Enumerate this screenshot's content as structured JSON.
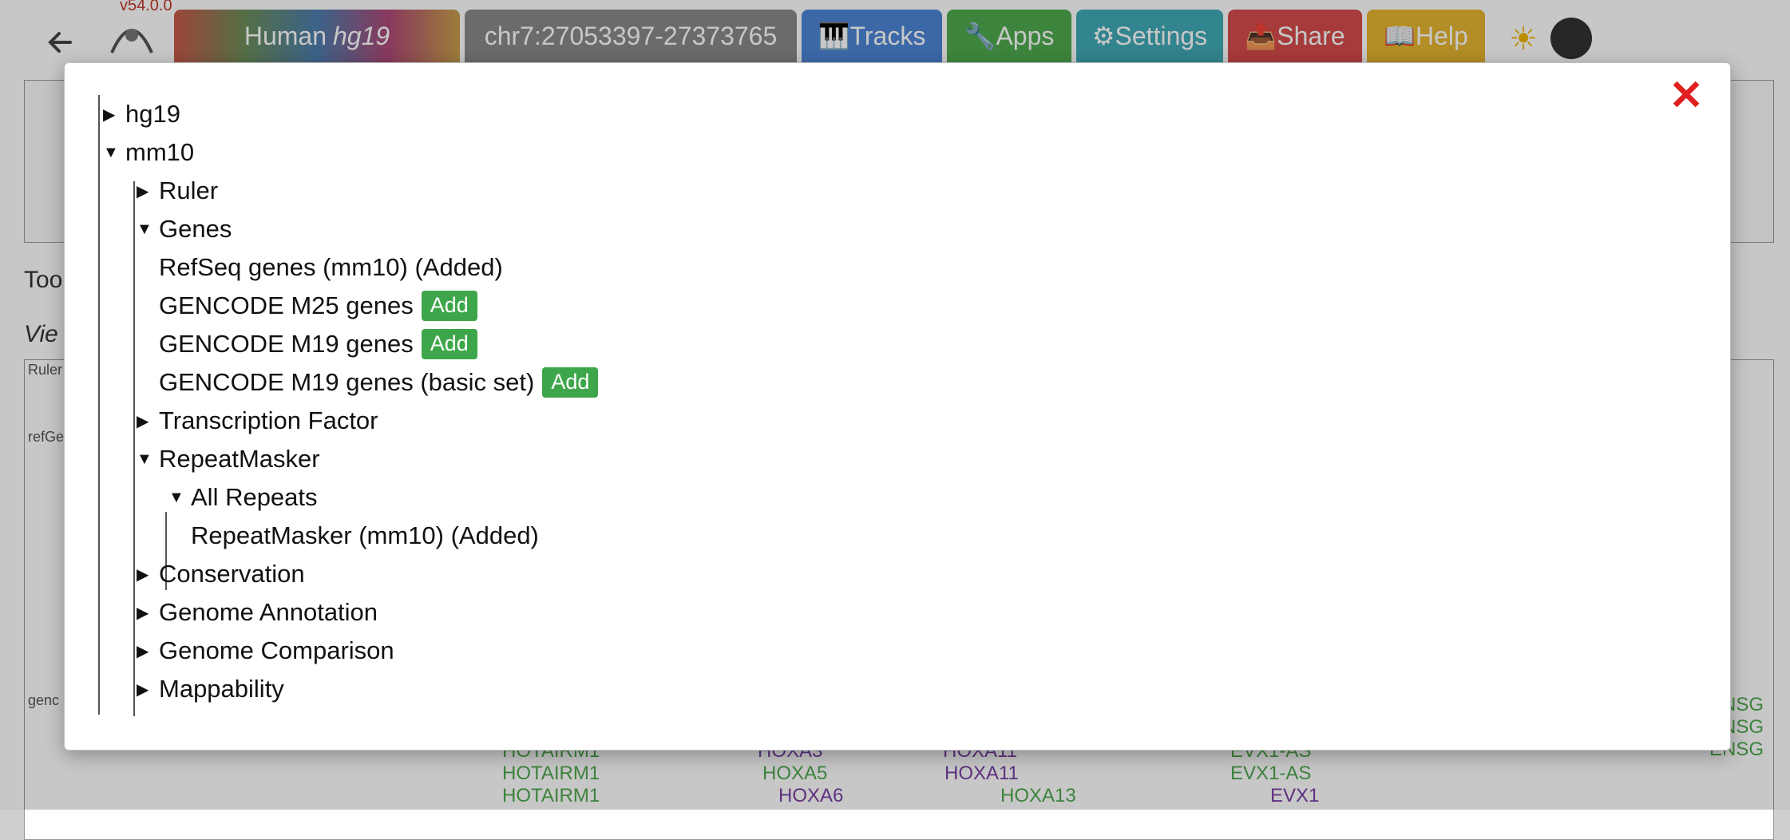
{
  "app": {
    "version": "v54.0.0",
    "genome_species": "Human",
    "genome_assembly": "hg19",
    "locus": "chr7:27053397-27373765",
    "nav": {
      "tracks": "🎹Tracks",
      "apps": "🔧Apps",
      "settings": "⚙Settings",
      "share": "📤Share",
      "help": "📖Help"
    },
    "background": {
      "tools_label": "Too",
      "view_label": "Vie",
      "ruler_label": "Ruler",
      "refgene_label": "refGe",
      "gencode_label": "genc",
      "genes": [
        "HOTAIRM1",
        "HOTAIRM1",
        "HOTAIRM1",
        "HOXA3",
        "HOXA5",
        "HOXA6",
        "HOXA11",
        "HOXA11",
        "HOXA13",
        "EVX1-AS",
        "EVX1-AS",
        "EVX1",
        "ENSG",
        "ENSG",
        "ENSG"
      ]
    }
  },
  "icons": {
    "back": "back-arrow-icon",
    "close": "close-icon",
    "expanded": "caret-down-icon",
    "collapsed": "caret-right-icon",
    "theme": "sun-icon"
  },
  "colors": {
    "add_button": "#3ea64a",
    "close": "#e02020",
    "tracks_tab": "#4d86d6",
    "apps_tab": "#4fab4f",
    "settings_tab": "#41a9b6",
    "share_tab": "#d64b4b",
    "help_tab": "#e6b530"
  },
  "tree": {
    "nodes": [
      {
        "label": "hg19",
        "state": "collapsed"
      },
      {
        "label": "mm10",
        "state": "expanded"
      },
      {
        "label": "Ruler",
        "state": "collapsed"
      },
      {
        "label": "Genes",
        "state": "expanded"
      },
      {
        "label": "RefSeq genes (mm10) (Added)"
      },
      {
        "label": "GENCODE M25 genes",
        "action": "Add"
      },
      {
        "label": "GENCODE M19 genes",
        "action": "Add"
      },
      {
        "label": "GENCODE M19 genes (basic set)",
        "action": "Add"
      },
      {
        "label": "Transcription Factor",
        "state": "collapsed"
      },
      {
        "label": "RepeatMasker",
        "state": "expanded"
      },
      {
        "label": "All Repeats",
        "state": "expanded"
      },
      {
        "label": "RepeatMasker (mm10) (Added)"
      },
      {
        "label": "Conservation",
        "state": "collapsed"
      },
      {
        "label": "Genome Annotation",
        "state": "collapsed"
      },
      {
        "label": "Genome Comparison",
        "state": "collapsed"
      },
      {
        "label": "Mappability",
        "state": "collapsed"
      }
    ]
  }
}
